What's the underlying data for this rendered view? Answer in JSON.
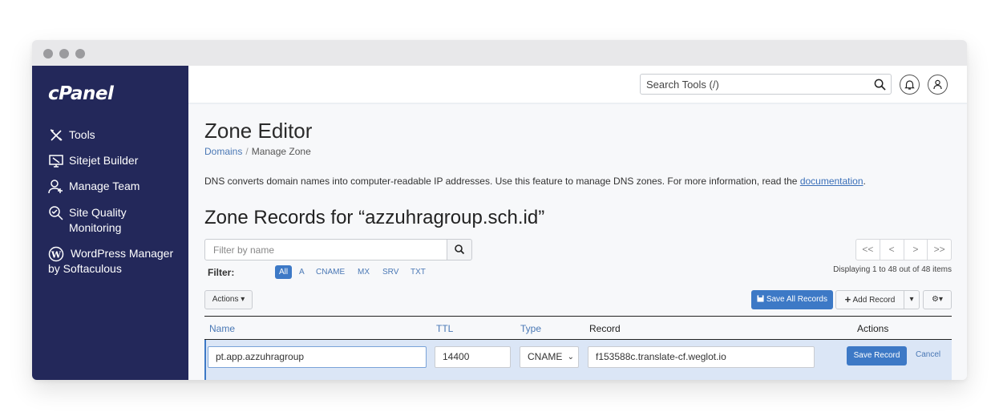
{
  "app": {
    "logo": "cPanel"
  },
  "sidebar": {
    "items": [
      {
        "label": "Tools",
        "icon": "tools-icon"
      },
      {
        "label": "Sitejet Builder",
        "icon": "monitor-icon"
      },
      {
        "label": "Manage Team",
        "icon": "team-icon"
      },
      {
        "label": "Site Quality Monitoring",
        "icon": "quality-icon"
      },
      {
        "label": "WordPress Manager by Softaculous",
        "icon": "wordpress-icon"
      }
    ]
  },
  "header": {
    "search_placeholder": "Search Tools (/)"
  },
  "page": {
    "title": "Zone Editor",
    "breadcrumb": {
      "parent": "Domains",
      "separator": "/",
      "current": "Manage Zone"
    },
    "description": "DNS converts domain names into computer-readable IP addresses. Use this feature to manage DNS zones. For more information, read the ",
    "description_link": "documentation",
    "description_end": ".",
    "records_title": "Zone Records for “azzuhragroup.sch.id”"
  },
  "filter": {
    "placeholder": "Filter by name",
    "label": "Filter:",
    "chips": [
      "All",
      "A",
      "CNAME",
      "MX",
      "SRV",
      "TXT"
    ],
    "active_chip": "All"
  },
  "pager": {
    "first": "<<",
    "prev": "<",
    "next": ">",
    "last": ">>",
    "info": "Displaying 1 to 48 out of 48 items"
  },
  "toolbar": {
    "actions": "Actions",
    "save_all": "Save All Records",
    "add_record": "Add Record"
  },
  "table": {
    "headers": {
      "name": "Name",
      "ttl": "TTL",
      "type": "Type",
      "record": "Record",
      "actions": "Actions"
    },
    "editing_row": {
      "name": "pt.app.azzuhragroup",
      "ttl": "14400",
      "type": "CNAME",
      "record": "f153588c.translate-cf.weglot.io",
      "save": "Save Record",
      "cancel": "Cancel"
    }
  },
  "colors": {
    "sidebar": "#23285a",
    "primary": "#3d79c6",
    "link": "#4a78b5"
  }
}
